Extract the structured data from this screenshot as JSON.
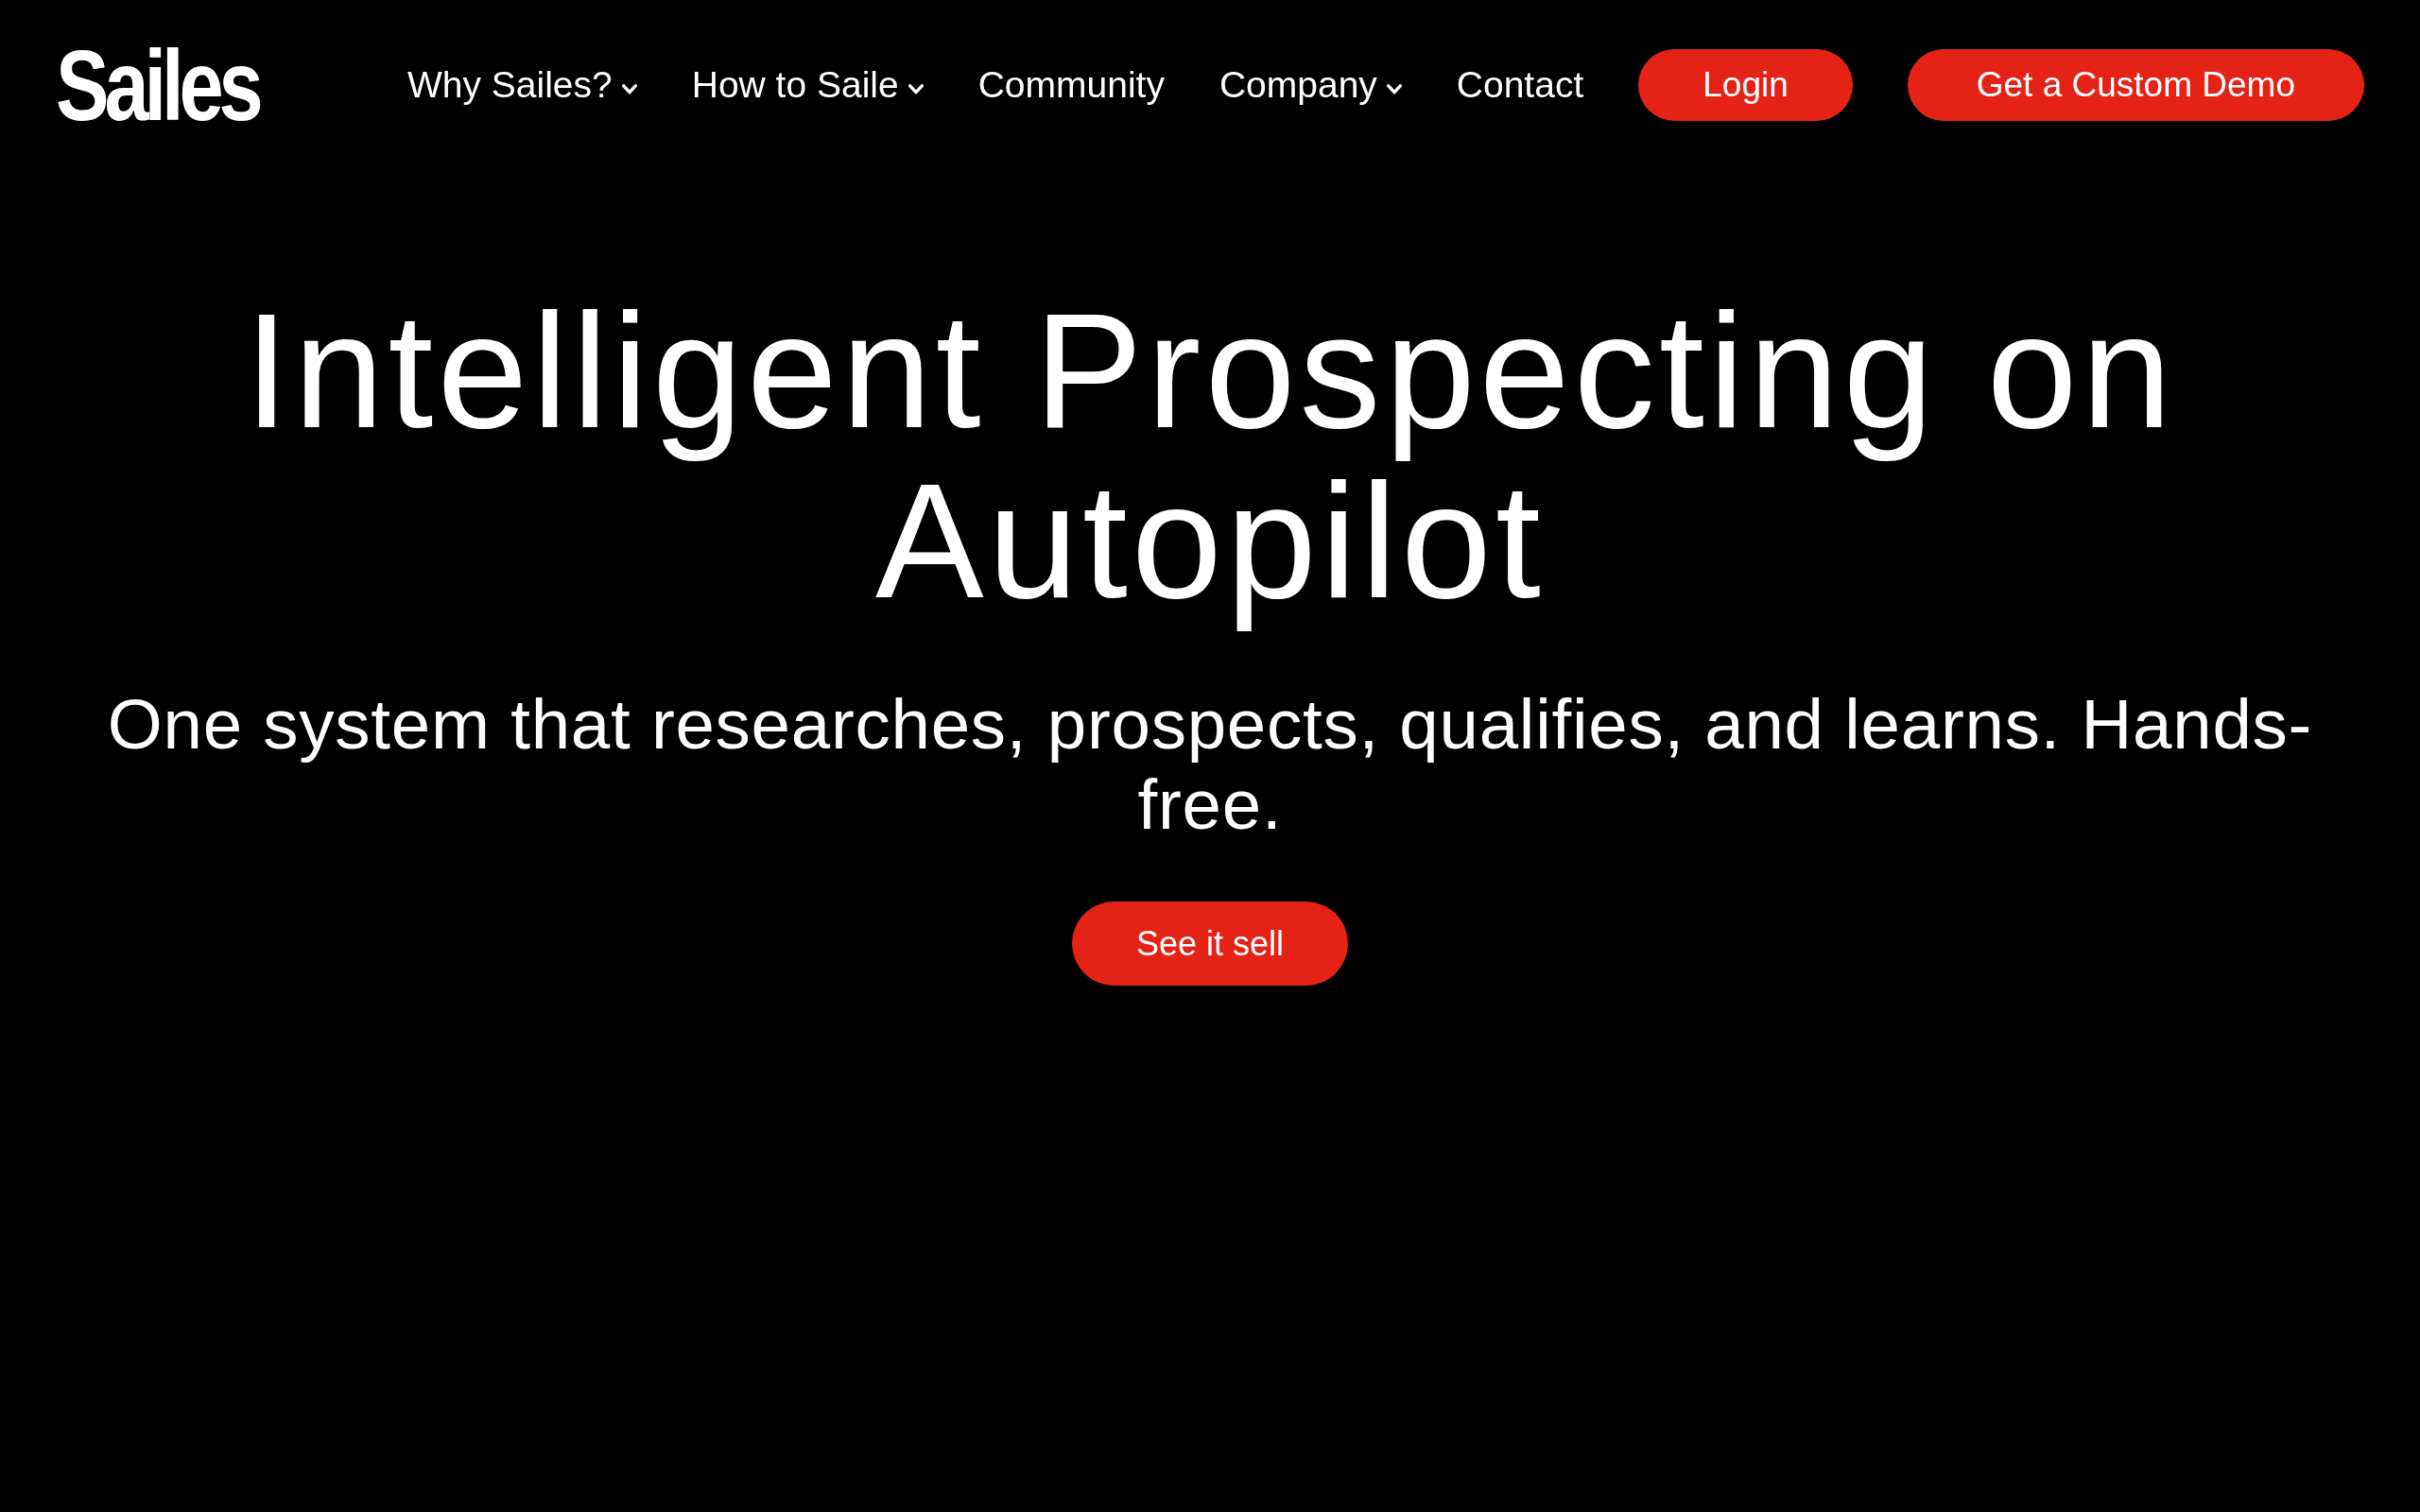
{
  "header": {
    "logo": "Sailes",
    "nav": [
      {
        "label": "Why Sailes?",
        "dropdown": true
      },
      {
        "label": "How to Saile",
        "dropdown": true
      },
      {
        "label": "Community",
        "dropdown": false
      },
      {
        "label": "Company",
        "dropdown": true
      },
      {
        "label": "Contact",
        "dropdown": false
      }
    ],
    "buttons": [
      {
        "label": "Login"
      },
      {
        "label": "Get a Custom Demo"
      }
    ]
  },
  "hero": {
    "title": "Intelligent Prospecting on Autopilot",
    "subtitle": "One system that researches, prospects, qualifies, and learns. Hands-free.",
    "button": "See it sell"
  }
}
